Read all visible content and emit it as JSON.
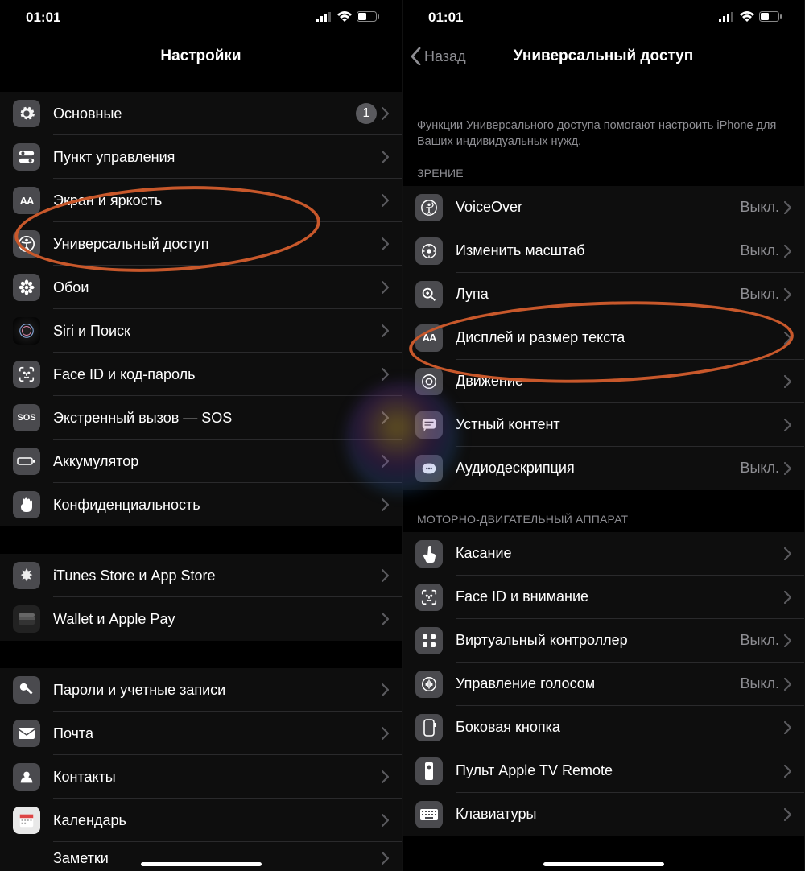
{
  "status": {
    "time": "01:01"
  },
  "left": {
    "title": "Настройки",
    "groups": [
      {
        "items": [
          {
            "icon": "gear",
            "label": "Основные",
            "badge": "1"
          },
          {
            "icon": "toggles",
            "label": "Пункт управления"
          },
          {
            "icon": "aa",
            "label": "Экран и яркость"
          },
          {
            "icon": "accessibility",
            "label": "Универсальный доступ"
          },
          {
            "icon": "flower",
            "label": "Обои"
          },
          {
            "icon": "siri",
            "label": "Siri и Поиск"
          },
          {
            "icon": "faceid",
            "label": "Face ID и код-пароль"
          },
          {
            "icon": "sos",
            "label": "Экстренный вызов — SOS"
          },
          {
            "icon": "battery",
            "label": "Аккумулятор"
          },
          {
            "icon": "hand",
            "label": "Конфиденциальность"
          }
        ]
      },
      {
        "items": [
          {
            "icon": "appstore",
            "label": "iTunes Store и App Store"
          },
          {
            "icon": "wallet",
            "label": "Wallet и Apple Pay"
          }
        ]
      },
      {
        "items": [
          {
            "icon": "key",
            "label": "Пароли и учетные записи"
          },
          {
            "icon": "mail",
            "label": "Почта"
          },
          {
            "icon": "contacts",
            "label": "Контакты"
          },
          {
            "icon": "calendar",
            "label": "Календарь"
          },
          {
            "icon": "notes",
            "label": "Заметки"
          }
        ]
      }
    ]
  },
  "right": {
    "back": "Назад",
    "title": "Универсальный доступ",
    "description": "Функции Универсального доступа помогают настроить iPhone для Ваших индивидуальных нужд.",
    "sec1_header": "ЗРЕНИЕ",
    "sec1_items": [
      {
        "icon": "voiceover",
        "label": "VoiceOver",
        "value": "Выкл."
      },
      {
        "icon": "zoom",
        "label": "Изменить масштаб",
        "value": "Выкл."
      },
      {
        "icon": "magnifier",
        "label": "Лупа",
        "value": "Выкл."
      },
      {
        "icon": "aa",
        "label": "Дисплей и размер текста"
      },
      {
        "icon": "motion",
        "label": "Движение"
      },
      {
        "icon": "speech",
        "label": "Устный контент"
      },
      {
        "icon": "audiodesc",
        "label": "Аудиодескрипция",
        "value": "Выкл."
      }
    ],
    "sec2_header": "МОТОРНО-ДВИГАТЕЛЬНЫЙ АППАРАТ",
    "sec2_items": [
      {
        "icon": "touch",
        "label": "Касание"
      },
      {
        "icon": "faceid",
        "label": "Face ID и внимание"
      },
      {
        "icon": "switch",
        "label": "Виртуальный контроллер",
        "value": "Выкл."
      },
      {
        "icon": "voice",
        "label": "Управление голосом",
        "value": "Выкл."
      },
      {
        "icon": "sidebtn",
        "label": "Боковая кнопка"
      },
      {
        "icon": "remote",
        "label": "Пульт Apple TV Remote"
      },
      {
        "icon": "keyboard",
        "label": "Клавиатуры"
      }
    ]
  }
}
